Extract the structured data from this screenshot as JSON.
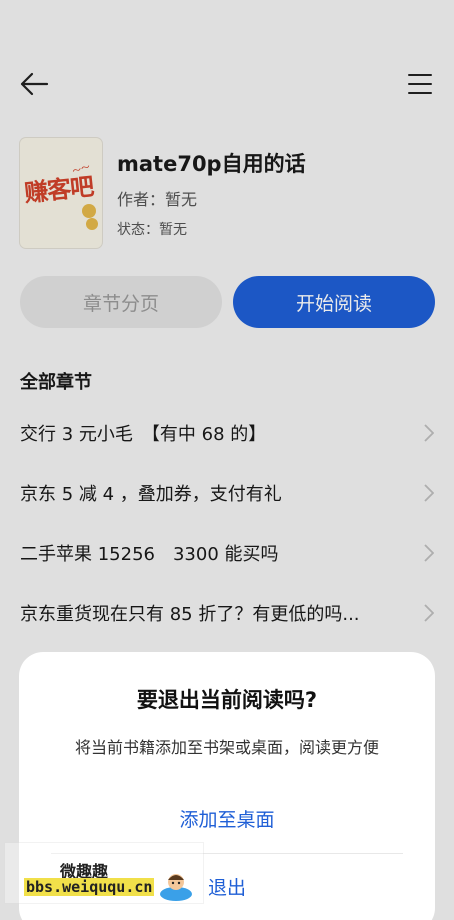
{
  "topbar": {
    "back_icon": "arrow-left-icon",
    "menu_icon": "hamburger-menu-icon"
  },
  "book": {
    "cover_text": "赚客吧",
    "title": "mate70p自用的话",
    "author": "作者：暂无",
    "status": "状态：暂无"
  },
  "actions": {
    "chapters_label": "章节分页",
    "start_label": "开始阅读"
  },
  "chapters_section": {
    "title": "全部章节",
    "items": [
      {
        "label": "交行 3 元小毛　【有中 68 的】"
      },
      {
        "label": "京东 5 减 4 ，叠加券，支付有礼"
      },
      {
        "label": "二手苹果 15256　3300 能买吗"
      },
      {
        "label": "京东重货现在只有 85 折了？有更低的吗..."
      }
    ]
  },
  "dialog": {
    "title": "要退出当前阅读吗?",
    "message": "将当前书籍添加至书架或桌面，阅读更方便",
    "add_label": "添加至桌面",
    "exit_label": "退出"
  },
  "watermark": {
    "title": "微趣趣",
    "url": "bbs.weiququ.cn"
  },
  "colors": {
    "accent": "#1f5fd6",
    "background": "#f2f2f2"
  }
}
